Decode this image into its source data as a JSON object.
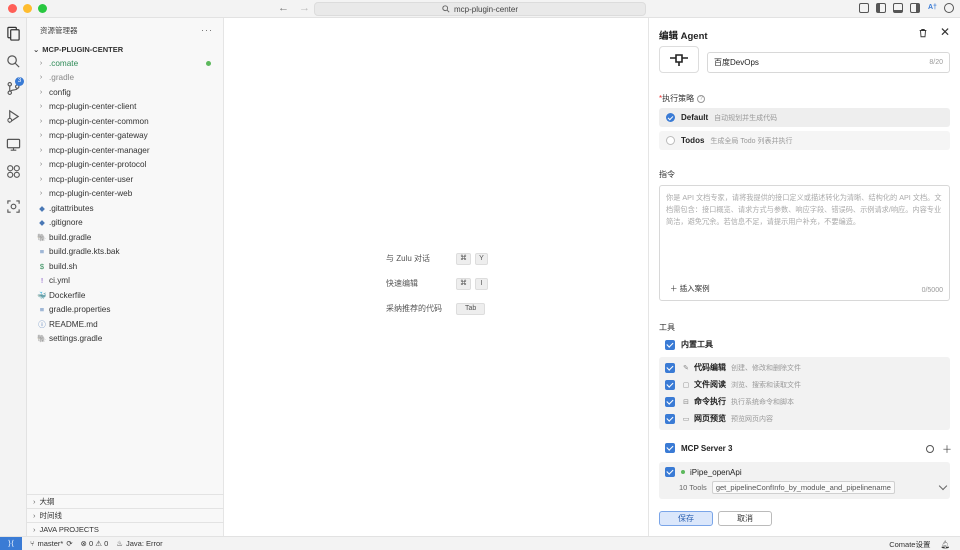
{
  "window": {
    "command_center": "mcp-plugin-center"
  },
  "explorer": {
    "title": "资源管理器",
    "more": "···",
    "root": "MCP-PLUGIN-CENTER",
    "items": [
      {
        "label": ".comate",
        "kind": "folder",
        "style": "green",
        "dot": true
      },
      {
        "label": ".gradle",
        "kind": "folder",
        "style": "dim"
      },
      {
        "label": "config",
        "kind": "folder"
      },
      {
        "label": "mcp-plugin-center-client",
        "kind": "folder"
      },
      {
        "label": "mcp-plugin-center-common",
        "kind": "folder"
      },
      {
        "label": "mcp-plugin-center-gateway",
        "kind": "folder"
      },
      {
        "label": "mcp-plugin-center-manager",
        "kind": "folder"
      },
      {
        "label": "mcp-plugin-center-protocol",
        "kind": "folder"
      },
      {
        "label": "mcp-plugin-center-user",
        "kind": "folder"
      },
      {
        "label": "mcp-plugin-center-web",
        "kind": "folder"
      },
      {
        "label": ".gitattributes",
        "kind": "file",
        "icon": "◆"
      },
      {
        "label": ".gitignore",
        "kind": "file",
        "icon": "◆"
      },
      {
        "label": "build.gradle",
        "kind": "file",
        "icon": "🐘"
      },
      {
        "label": "build.gradle.kts.bak",
        "kind": "file",
        "icon": "≡"
      },
      {
        "label": "build.sh",
        "kind": "file",
        "icon": "$"
      },
      {
        "label": "ci.yml",
        "kind": "file",
        "icon": "!"
      },
      {
        "label": "Dockerfile",
        "kind": "file",
        "icon": "🐳"
      },
      {
        "label": "gradle.properties",
        "kind": "file",
        "icon": "≡"
      },
      {
        "label": "README.md",
        "kind": "file",
        "icon": "ⓘ"
      },
      {
        "label": "settings.gradle",
        "kind": "file",
        "icon": "🐘"
      }
    ],
    "sections": [
      "大纲",
      "时间线",
      "JAVA PROJECTS"
    ]
  },
  "activity": {
    "scm_badge": "3"
  },
  "editor": {
    "shortcuts": [
      {
        "label": "与 Zulu 对话",
        "keys": [
          "⌘",
          "Y"
        ]
      },
      {
        "label": "快速编辑",
        "keys": [
          "⌘",
          "I"
        ]
      },
      {
        "label": "采纳推荐的代码",
        "keys": [
          "Tab"
        ]
      }
    ]
  },
  "agent_panel": {
    "title": "编辑 Agent",
    "name_value": "百度DevOps",
    "name_count": "8/20",
    "strategy_label": "执行策略",
    "strategy_required": "*",
    "strategies": [
      {
        "name": "Default",
        "desc": "自动规划并生成代码",
        "selected": true
      },
      {
        "name": "Todos",
        "desc": "生成全局 Todo 列表并执行",
        "selected": false
      }
    ],
    "instructions_label": "指令",
    "instructions_placeholder": "你是 API 文档专家，请将我提供的接口定义或描述转化为清晰、结构化的 API 文档。文档需包含：接口概览、请求方式与参数、响应字段、错误码、示例请求/响应。内容专业简洁，避免冗余。若信息不足，请提示用户补充，不要编造。",
    "insert_example": "插入案例",
    "instructions_count": "0/5000",
    "tools_label": "工具",
    "builtin_tools_label": "内置工具",
    "builtin_tools": [
      {
        "name": "代码编辑",
        "desc": "创建、修改和删除文件",
        "icon": "✎"
      },
      {
        "name": "文件阅读",
        "desc": "浏览、搜索和读取文件",
        "icon": "▢"
      },
      {
        "name": "命令执行",
        "desc": "执行系统命令和脚本",
        "icon": "⊟"
      },
      {
        "name": "网页预览",
        "desc": "预览网页内容",
        "icon": "▭"
      }
    ],
    "mcp_label": "MCP Server 3",
    "mcp_server": {
      "name": "iPipe_openApi",
      "tools_count": "10 Tools",
      "tool_tag": "get_pipelineConfInfo_by_module_and_pipelinename"
    },
    "save": "保存",
    "cancel": "取消"
  },
  "statusbar": {
    "branch": "master*",
    "problems": "⊗ 0 ⚠ 0",
    "java": "Java: Error",
    "comate": "Comate设置"
  },
  "colors": {
    "accent": "#3a7bd5",
    "green": "#5cb85c"
  }
}
